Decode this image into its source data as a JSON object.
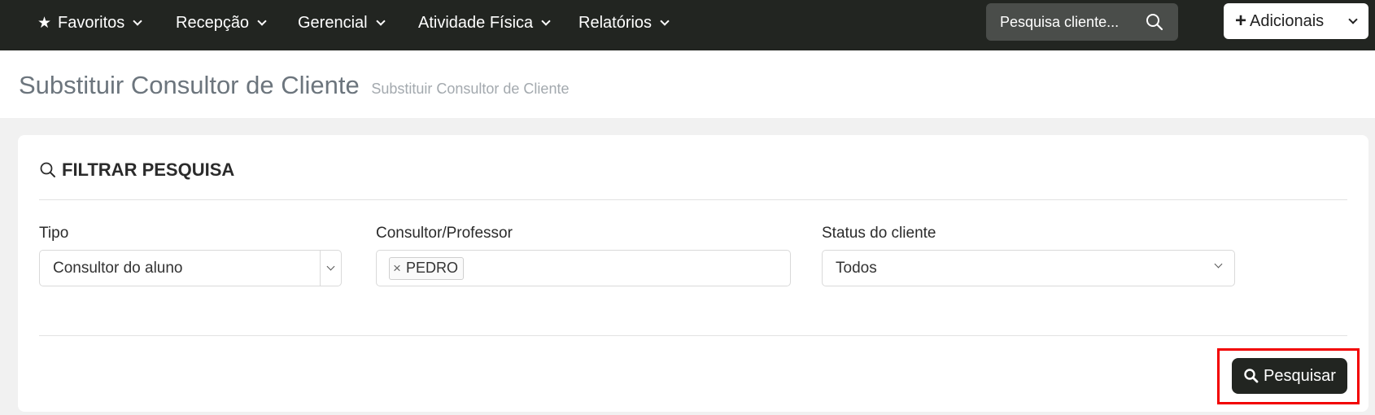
{
  "nav": {
    "items": [
      {
        "label": "Favoritos"
      },
      {
        "label": "Recepção"
      },
      {
        "label": "Gerencial"
      },
      {
        "label": "Atividade Física"
      },
      {
        "label": "Relatórios"
      }
    ],
    "search_placeholder": "Pesquisa cliente...",
    "add_label": "Adicionais"
  },
  "header": {
    "title": "Substituir Consultor de Cliente",
    "subtitle": "Substituir Consultor de Cliente"
  },
  "filter": {
    "title": "FILTRAR PESQUISA",
    "tipo": {
      "label": "Tipo",
      "value": "Consultor do aluno"
    },
    "consultor": {
      "label": "Consultor/Professor",
      "tags": [
        {
          "label": "PEDRO"
        }
      ]
    },
    "status": {
      "label": "Status do cliente",
      "value": "Todos"
    },
    "search_button": "Pesquisar"
  },
  "colors": {
    "navbar": "#222521",
    "highlight": "#f20000"
  },
  "icons": [
    "star-icon",
    "chevron-down-icon",
    "search-icon",
    "plus-icon",
    "close-icon"
  ]
}
